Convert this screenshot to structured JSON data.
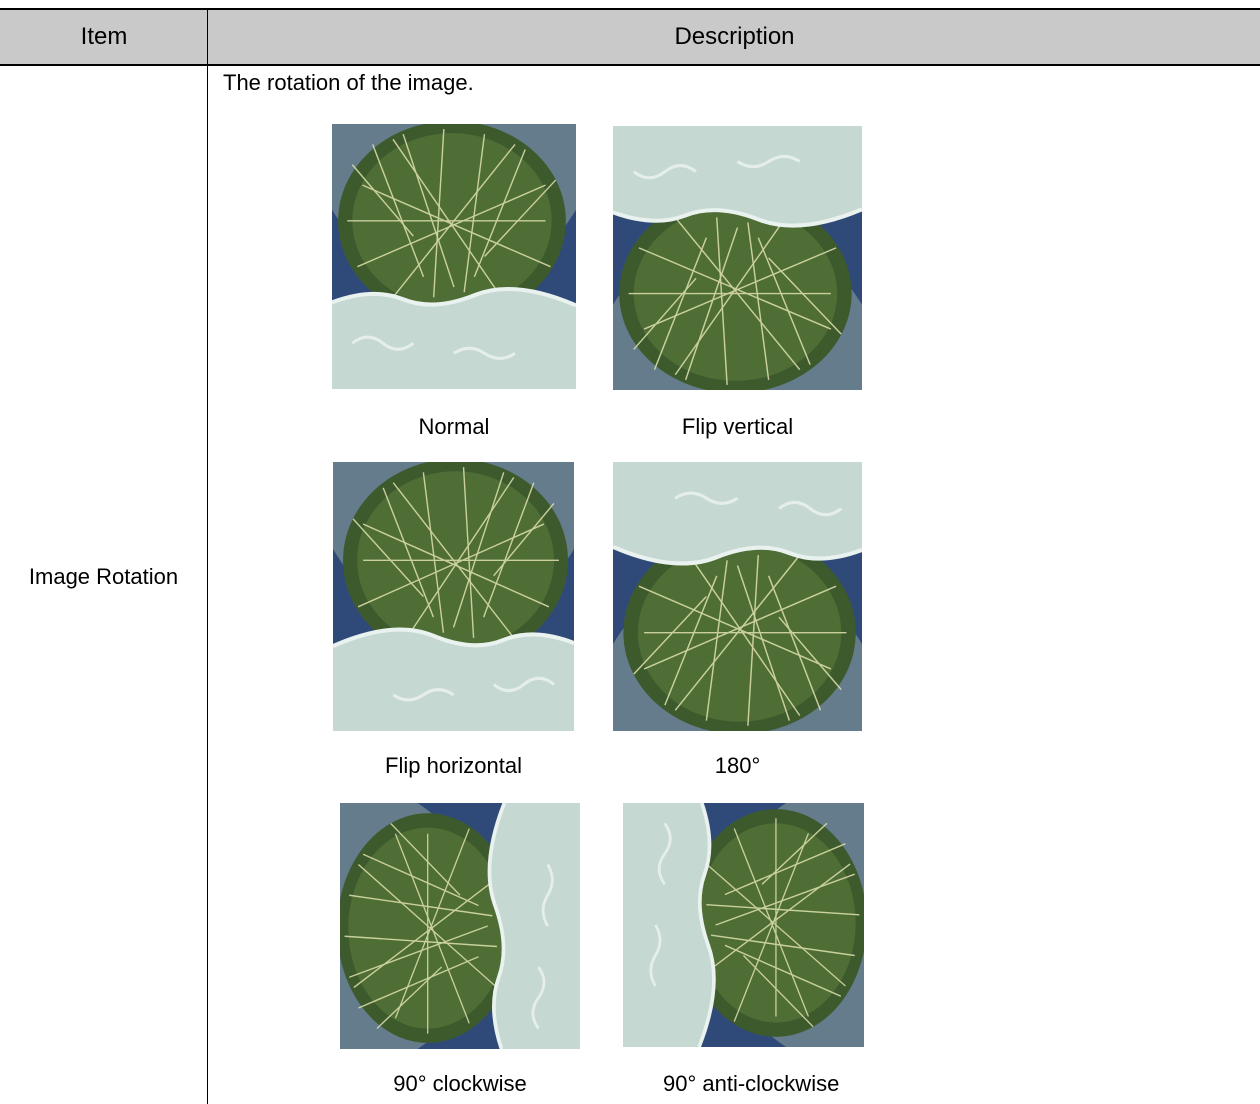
{
  "table": {
    "headers": {
      "item": "Item",
      "description": "Description"
    },
    "row": {
      "item": "Image Rotation",
      "intro": "The rotation of the image."
    }
  },
  "figures": {
    "normal": "Normal",
    "flip_vertical": "Flip vertical",
    "flip_horizontal": "Flip horizontal",
    "rotate_180": "180°",
    "rotate_90_cw": "90° clockwise",
    "rotate_90_ccw": "90° anti-clockwise"
  },
  "colors": {
    "header_background": "#c9c9c9",
    "rules": "#000000"
  },
  "icons": [
    "cactus-photo"
  ]
}
